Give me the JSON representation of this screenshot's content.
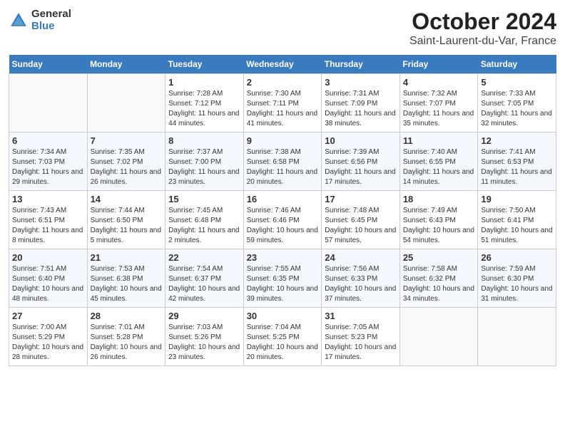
{
  "header": {
    "logo_line1": "General",
    "logo_line2": "Blue",
    "title": "October 2024",
    "subtitle": "Saint-Laurent-du-Var, France"
  },
  "weekdays": [
    "Sunday",
    "Monday",
    "Tuesday",
    "Wednesday",
    "Thursday",
    "Friday",
    "Saturday"
  ],
  "weeks": [
    [
      {
        "day": "",
        "sunrise": "",
        "sunset": "",
        "daylight": ""
      },
      {
        "day": "",
        "sunrise": "",
        "sunset": "",
        "daylight": ""
      },
      {
        "day": "1",
        "sunrise": "Sunrise: 7:28 AM",
        "sunset": "Sunset: 7:12 PM",
        "daylight": "Daylight: 11 hours and 44 minutes."
      },
      {
        "day": "2",
        "sunrise": "Sunrise: 7:30 AM",
        "sunset": "Sunset: 7:11 PM",
        "daylight": "Daylight: 11 hours and 41 minutes."
      },
      {
        "day": "3",
        "sunrise": "Sunrise: 7:31 AM",
        "sunset": "Sunset: 7:09 PM",
        "daylight": "Daylight: 11 hours and 38 minutes."
      },
      {
        "day": "4",
        "sunrise": "Sunrise: 7:32 AM",
        "sunset": "Sunset: 7:07 PM",
        "daylight": "Daylight: 11 hours and 35 minutes."
      },
      {
        "day": "5",
        "sunrise": "Sunrise: 7:33 AM",
        "sunset": "Sunset: 7:05 PM",
        "daylight": "Daylight: 11 hours and 32 minutes."
      }
    ],
    [
      {
        "day": "6",
        "sunrise": "Sunrise: 7:34 AM",
        "sunset": "Sunset: 7:03 PM",
        "daylight": "Daylight: 11 hours and 29 minutes."
      },
      {
        "day": "7",
        "sunrise": "Sunrise: 7:35 AM",
        "sunset": "Sunset: 7:02 PM",
        "daylight": "Daylight: 11 hours and 26 minutes."
      },
      {
        "day": "8",
        "sunrise": "Sunrise: 7:37 AM",
        "sunset": "Sunset: 7:00 PM",
        "daylight": "Daylight: 11 hours and 23 minutes."
      },
      {
        "day": "9",
        "sunrise": "Sunrise: 7:38 AM",
        "sunset": "Sunset: 6:58 PM",
        "daylight": "Daylight: 11 hours and 20 minutes."
      },
      {
        "day": "10",
        "sunrise": "Sunrise: 7:39 AM",
        "sunset": "Sunset: 6:56 PM",
        "daylight": "Daylight: 11 hours and 17 minutes."
      },
      {
        "day": "11",
        "sunrise": "Sunrise: 7:40 AM",
        "sunset": "Sunset: 6:55 PM",
        "daylight": "Daylight: 11 hours and 14 minutes."
      },
      {
        "day": "12",
        "sunrise": "Sunrise: 7:41 AM",
        "sunset": "Sunset: 6:53 PM",
        "daylight": "Daylight: 11 hours and 11 minutes."
      }
    ],
    [
      {
        "day": "13",
        "sunrise": "Sunrise: 7:43 AM",
        "sunset": "Sunset: 6:51 PM",
        "daylight": "Daylight: 11 hours and 8 minutes."
      },
      {
        "day": "14",
        "sunrise": "Sunrise: 7:44 AM",
        "sunset": "Sunset: 6:50 PM",
        "daylight": "Daylight: 11 hours and 5 minutes."
      },
      {
        "day": "15",
        "sunrise": "Sunrise: 7:45 AM",
        "sunset": "Sunset: 6:48 PM",
        "daylight": "Daylight: 11 hours and 2 minutes."
      },
      {
        "day": "16",
        "sunrise": "Sunrise: 7:46 AM",
        "sunset": "Sunset: 6:46 PM",
        "daylight": "Daylight: 10 hours and 59 minutes."
      },
      {
        "day": "17",
        "sunrise": "Sunrise: 7:48 AM",
        "sunset": "Sunset: 6:45 PM",
        "daylight": "Daylight: 10 hours and 57 minutes."
      },
      {
        "day": "18",
        "sunrise": "Sunrise: 7:49 AM",
        "sunset": "Sunset: 6:43 PM",
        "daylight": "Daylight: 10 hours and 54 minutes."
      },
      {
        "day": "19",
        "sunrise": "Sunrise: 7:50 AM",
        "sunset": "Sunset: 6:41 PM",
        "daylight": "Daylight: 10 hours and 51 minutes."
      }
    ],
    [
      {
        "day": "20",
        "sunrise": "Sunrise: 7:51 AM",
        "sunset": "Sunset: 6:40 PM",
        "daylight": "Daylight: 10 hours and 48 minutes."
      },
      {
        "day": "21",
        "sunrise": "Sunrise: 7:53 AM",
        "sunset": "Sunset: 6:38 PM",
        "daylight": "Daylight: 10 hours and 45 minutes."
      },
      {
        "day": "22",
        "sunrise": "Sunrise: 7:54 AM",
        "sunset": "Sunset: 6:37 PM",
        "daylight": "Daylight: 10 hours and 42 minutes."
      },
      {
        "day": "23",
        "sunrise": "Sunrise: 7:55 AM",
        "sunset": "Sunset: 6:35 PM",
        "daylight": "Daylight: 10 hours and 39 minutes."
      },
      {
        "day": "24",
        "sunrise": "Sunrise: 7:56 AM",
        "sunset": "Sunset: 6:33 PM",
        "daylight": "Daylight: 10 hours and 37 minutes."
      },
      {
        "day": "25",
        "sunrise": "Sunrise: 7:58 AM",
        "sunset": "Sunset: 6:32 PM",
        "daylight": "Daylight: 10 hours and 34 minutes."
      },
      {
        "day": "26",
        "sunrise": "Sunrise: 7:59 AM",
        "sunset": "Sunset: 6:30 PM",
        "daylight": "Daylight: 10 hours and 31 minutes."
      }
    ],
    [
      {
        "day": "27",
        "sunrise": "Sunrise: 7:00 AM",
        "sunset": "Sunset: 5:29 PM",
        "daylight": "Daylight: 10 hours and 28 minutes."
      },
      {
        "day": "28",
        "sunrise": "Sunrise: 7:01 AM",
        "sunset": "Sunset: 5:28 PM",
        "daylight": "Daylight: 10 hours and 26 minutes."
      },
      {
        "day": "29",
        "sunrise": "Sunrise: 7:03 AM",
        "sunset": "Sunset: 5:26 PM",
        "daylight": "Daylight: 10 hours and 23 minutes."
      },
      {
        "day": "30",
        "sunrise": "Sunrise: 7:04 AM",
        "sunset": "Sunset: 5:25 PM",
        "daylight": "Daylight: 10 hours and 20 minutes."
      },
      {
        "day": "31",
        "sunrise": "Sunrise: 7:05 AM",
        "sunset": "Sunset: 5:23 PM",
        "daylight": "Daylight: 10 hours and 17 minutes."
      },
      {
        "day": "",
        "sunrise": "",
        "sunset": "",
        "daylight": ""
      },
      {
        "day": "",
        "sunrise": "",
        "sunset": "",
        "daylight": ""
      }
    ]
  ]
}
